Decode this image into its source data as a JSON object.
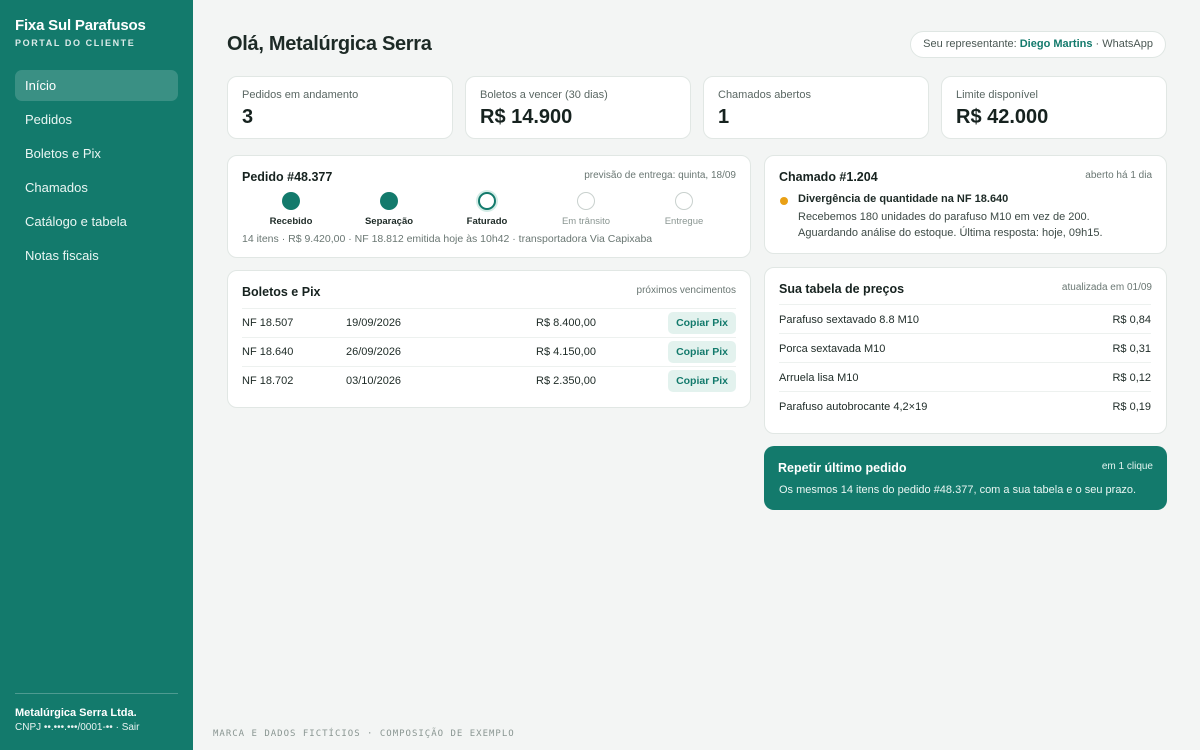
{
  "brand": {
    "name": "Fixa Sul Parafusos",
    "subtitle": "PORTAL DO CLIENTE"
  },
  "nav": [
    {
      "label": "Início",
      "active": true
    },
    {
      "label": "Pedidos"
    },
    {
      "label": "Boletos e Pix"
    },
    {
      "label": "Chamados"
    },
    {
      "label": "Catálogo e tabela"
    },
    {
      "label": "Notas fiscais"
    }
  ],
  "account": {
    "company": "Metalúrgica Serra Ltda.",
    "cnpj": "CNPJ ••.•••.•••/0001-•• · ",
    "logout": "Sair"
  },
  "header": {
    "greeting": "Olá, Metalúrgica Serra",
    "rep_prefix": "Seu representante: ",
    "rep_name": "Diego Martins",
    "rep_sep": " · ",
    "rep_channel": "WhatsApp"
  },
  "stats": [
    {
      "label": "Pedidos em andamento",
      "value": "3"
    },
    {
      "label": "Boletos a vencer (30 dias)",
      "value": "R$ 14.900"
    },
    {
      "label": "Chamados abertos",
      "value": "1"
    },
    {
      "label": "Limite disponível",
      "value": "R$ 42.000"
    }
  ],
  "order": {
    "title": "Pedido #48.377",
    "delivery": "previsão de entrega: quinta, 18/09",
    "steps": [
      {
        "label": "Recebido",
        "state": "done"
      },
      {
        "label": "Separação",
        "state": "done"
      },
      {
        "label": "Faturado",
        "state": "current"
      },
      {
        "label": "Em trânsito",
        "state": "todo"
      },
      {
        "label": "Entregue",
        "state": "todo"
      }
    ],
    "info": "14 itens · R$ 9.420,00 · NF 18.812 emitida hoje às 10h42 · transportadora Via Capixaba"
  },
  "boletos": {
    "title": "Boletos e Pix",
    "meta": "próximos vencimentos",
    "rows": [
      {
        "nf": "NF 18.507",
        "date": "19/09/2026",
        "value": "R$ 8.400,00",
        "action": "Copiar Pix"
      },
      {
        "nf": "NF 18.640",
        "date": "26/09/2026",
        "value": "R$ 4.150,00",
        "action": "Copiar Pix"
      },
      {
        "nf": "NF 18.702",
        "date": "03/10/2026",
        "value": "R$ 2.350,00",
        "action": "Copiar Pix"
      }
    ]
  },
  "ticket": {
    "title": "Chamado #1.204",
    "meta": "aberto há 1 dia",
    "status_color": "#e9a015",
    "headline": "Divergência de quantidade na NF 18.640",
    "line1": "Recebemos 180 unidades do parafuso M10 em vez de 200.",
    "line2": "Aguardando análise do estoque. Última resposta: hoje, 09h15."
  },
  "prices": {
    "title": "Sua tabela de preços",
    "meta": "atualizada em 01/09",
    "rows": [
      {
        "name": "Parafuso sextavado 8.8 M10",
        "price": "R$ 0,84"
      },
      {
        "name": "Porca sextavada M10",
        "price": "R$ 0,31"
      },
      {
        "name": "Arruela lisa M10",
        "price": "R$ 0,12"
      },
      {
        "name": "Parafuso autobrocante 4,2×19",
        "price": "R$ 0,19"
      }
    ]
  },
  "repeat": {
    "title": "Repetir último pedido",
    "meta": "em 1 clique",
    "desc": "Os mesmos 14 itens do pedido #48.377, com a sua tabela e o seu prazo."
  },
  "footer": "MARCA E DADOS FICTÍCIOS · COMPOSIÇÃO DE EXEMPLO",
  "colors": {
    "brand": "#137a6c",
    "accent_soft": "#e3f2ee",
    "warning": "#e9a015"
  }
}
